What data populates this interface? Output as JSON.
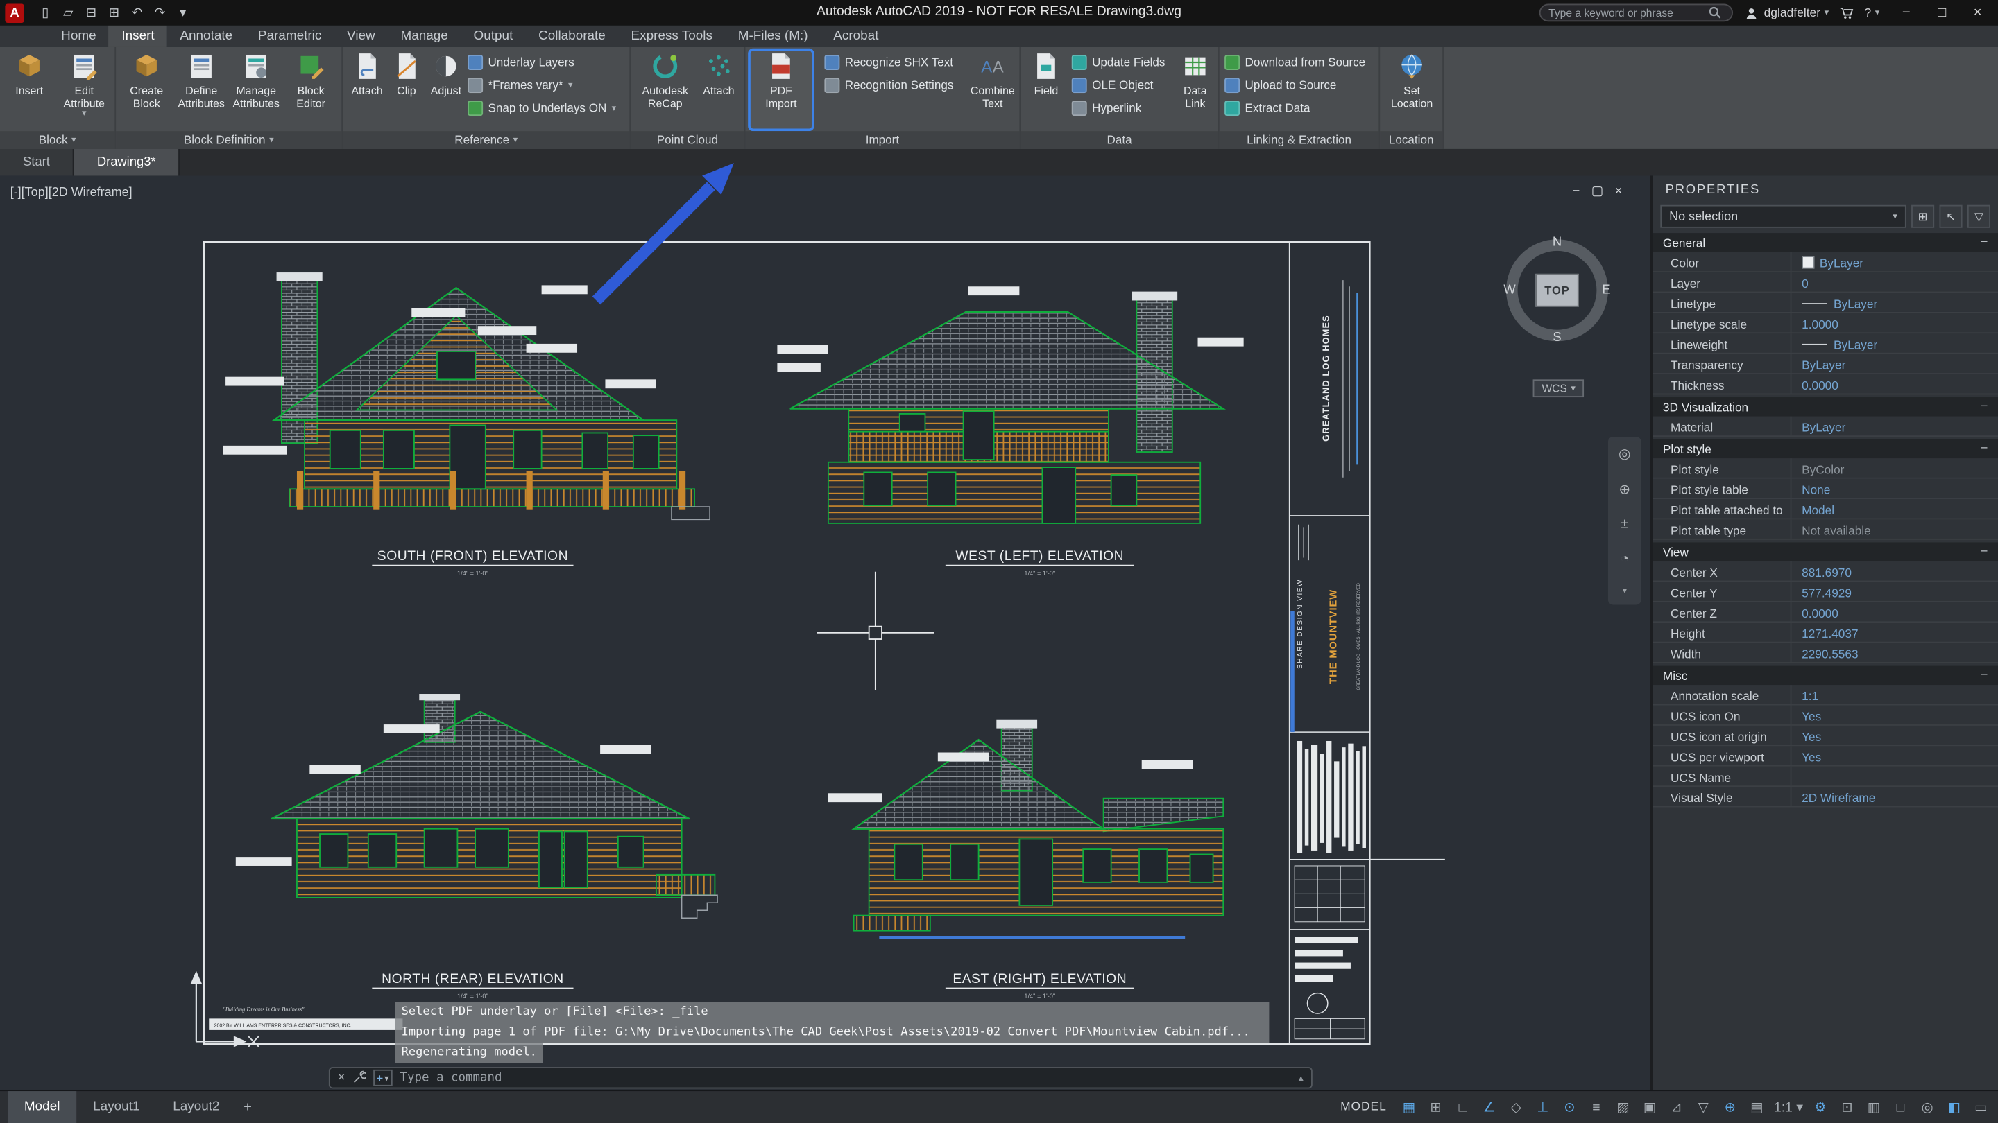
{
  "accent": {
    "highlight_blue": "#3d82e8",
    "value_blue": "#74a4d0",
    "cad_green": "#0fae3c",
    "log_orange": "#c9872d",
    "annotation_arrow_blue": "#2f5bd7"
  },
  "titlebar": {
    "app_title": "Autodesk AutoCAD 2019 - NOT FOR RESALE    Drawing3.dwg",
    "search_placeholder": "Type a keyword or phrase",
    "username": "dgladfelter",
    "help": "?",
    "qat_icons": [
      {
        "name": "new-file-icon",
        "glyph": "▯"
      },
      {
        "name": "open-file-icon",
        "glyph": "▱"
      },
      {
        "name": "save-icon",
        "glyph": "⊟"
      },
      {
        "name": "plot-icon",
        "glyph": "⊞"
      },
      {
        "name": "undo-icon",
        "glyph": "↶"
      },
      {
        "name": "redo-icon",
        "glyph": "↷"
      },
      {
        "name": "qat-dropdown-icon",
        "glyph": "▾"
      }
    ],
    "window": {
      "minimize": "−",
      "maximize": "□",
      "close": "×"
    }
  },
  "ribbon_tabs": [
    {
      "label": "Home"
    },
    {
      "label": "Insert",
      "active": true
    },
    {
      "label": "Annotate"
    },
    {
      "label": "Parametric"
    },
    {
      "label": "View"
    },
    {
      "label": "Manage"
    },
    {
      "label": "Output"
    },
    {
      "label": "Collaborate"
    },
    {
      "label": "Express Tools"
    },
    {
      "label": "M-Files (M:)"
    },
    {
      "label": "Acrobat"
    }
  ],
  "ribbon": {
    "block": {
      "label": "Block",
      "insert": "Insert",
      "edit_attribute": "Edit Attribute"
    },
    "block_definition": {
      "label": "Block Definition",
      "create_block": "Create Block",
      "define_attributes": "Define Attributes",
      "manage_attributes": "Manage Attributes",
      "block_editor": "Block Editor"
    },
    "reference": {
      "label": "Reference",
      "attach": "Attach",
      "clip": "Clip",
      "adjust": "Adjust",
      "underlay_layers": "Underlay Layers",
      "frames": "*Frames vary*",
      "snap": "Snap to Underlays ON"
    },
    "point_cloud": {
      "label": "Point Cloud",
      "recap": "Autodesk ReCap",
      "attach": "Attach"
    },
    "import": {
      "label": "Import",
      "pdf_import": "PDF Import",
      "recognize": "Recognize SHX Text",
      "settings": "Recognition Settings",
      "combine": "Combine Text"
    },
    "data": {
      "label": "Data",
      "field": "Field",
      "update_fields": "Update Fields",
      "ole_object": "OLE Object",
      "hyperlink": "Hyperlink",
      "data_link": "Data Link"
    },
    "linking": {
      "label": "Linking & Extraction",
      "download": "Download from Source",
      "upload": "Upload to Source",
      "extract": "Extract Data"
    },
    "location": {
      "label": "Location",
      "set_location": "Set Location"
    }
  },
  "file_tabs": [
    {
      "label": "Start"
    },
    {
      "label": "Drawing3*",
      "active": true
    }
  ],
  "viewport": {
    "label": "[-][Top][2D Wireframe]",
    "compass": {
      "n": "N",
      "w": "W",
      "e": "E",
      "s": "S",
      "top": "TOP",
      "wcs": "WCS"
    }
  },
  "drawing": {
    "elevations": [
      {
        "label": "SOUTH (FRONT) ELEVATION",
        "scale": "1/4\" = 1'-0\""
      },
      {
        "label": "WEST (LEFT) ELEVATION",
        "scale": "1/4\" = 1'-0\""
      },
      {
        "label": "NORTH (REAR) ELEVATION",
        "scale": "1/4\" = 1'-0\""
      },
      {
        "label": "EAST (RIGHT) ELEVATION",
        "scale": "1/4\" = 1'-0\""
      }
    ],
    "title_block": {
      "company": "GREATLAND LOG HOMES",
      "project": "THE MOUNTVIEW",
      "share": "SHARE DESIGN VIEW",
      "rights": "GREATLAND LOG HOMES · ALL RIGHTS RESERVED",
      "motto": "\"Building Dreams is Our Business\"",
      "copyright": "2002 BY WILLIAMS ENTERPRISES & CONSTRUCTORS, INC."
    }
  },
  "command": {
    "history": [
      "Select PDF underlay or [File] <File>: _file",
      "Importing page 1 of PDF file: G:\\My Drive\\Documents\\The CAD Geek\\Post Assets\\2019-02 Convert PDF\\Mountview Cabin.pdf...",
      "Regenerating model."
    ],
    "prompt": "Type a command"
  },
  "layout_tabs": [
    {
      "label": "Model",
      "active": true
    },
    {
      "label": "Layout1"
    },
    {
      "label": "Layout2"
    }
  ],
  "statusbar": {
    "model_label": "MODEL",
    "icons": [
      {
        "name": "grid-icon",
        "glyph": "▦",
        "on": true
      },
      {
        "name": "snap-mode-icon",
        "glyph": "⊞",
        "on": false
      },
      {
        "name": "ortho-icon",
        "glyph": "∟",
        "on": false
      },
      {
        "name": "polar-tracking-icon",
        "glyph": "∠",
        "on": true
      },
      {
        "name": "isometric-drafting-icon",
        "glyph": "◇",
        "on": false
      },
      {
        "name": "osnap-tracking-icon",
        "glyph": "⊥",
        "on": true
      },
      {
        "name": "object-snap-icon",
        "glyph": "⊙",
        "on": true
      },
      {
        "name": "lineweight-icon",
        "glyph": "≡",
        "on": false
      },
      {
        "name": "transparency-icon",
        "glyph": "▨",
        "on": false
      },
      {
        "name": "selection-cycling-icon",
        "glyph": "▣",
        "on": false
      },
      {
        "name": "dynamic-ucs-icon",
        "glyph": "⊿",
        "on": false
      },
      {
        "name": "selection-filter-icon",
        "glyph": "▽",
        "on": false
      },
      {
        "name": "gizmo-icon",
        "glyph": "⊕",
        "on": true
      },
      {
        "name": "annotation-visibility-icon",
        "glyph": "▤",
        "on": false
      },
      {
        "name": "annotation-scale-control",
        "glyph": "1:1 ▾",
        "on": false
      },
      {
        "name": "workspace-gear-icon",
        "glyph": "⚙",
        "on": true
      },
      {
        "name": "annotation-monitor-icon",
        "glyph": "⊡",
        "on": false
      },
      {
        "name": "quick-properties-icon",
        "glyph": "▥",
        "on": false
      },
      {
        "name": "lock-ui-icon",
        "glyph": "□",
        "on": false
      },
      {
        "name": "isolate-objects-icon",
        "glyph": "◎",
        "on": false
      },
      {
        "name": "graphics-performance-icon",
        "glyph": "◧",
        "on": true
      },
      {
        "name": "clean-screen-icon",
        "glyph": "▭",
        "on": false
      }
    ]
  },
  "properties": {
    "title": "PROPERTIES",
    "selection": "No selection",
    "sections": [
      {
        "name": "General",
        "rows": [
          {
            "label": "Color",
            "value": "ByLayer"
          },
          {
            "label": "Layer",
            "value": "0"
          },
          {
            "label": "Linetype",
            "value": "ByLayer"
          },
          {
            "label": "Linetype scale",
            "value": "1.0000"
          },
          {
            "label": "Lineweight",
            "value": "ByLayer"
          },
          {
            "label": "Transparency",
            "value": "ByLayer"
          },
          {
            "label": "Thickness",
            "value": "0.0000"
          }
        ]
      },
      {
        "name": "3D Visualization",
        "rows": [
          {
            "label": "Material",
            "value": "ByLayer"
          }
        ]
      },
      {
        "name": "Plot style",
        "rows": [
          {
            "label": "Plot style",
            "value": "ByColor"
          },
          {
            "label": "Plot style table",
            "value": "None"
          },
          {
            "label": "Plot table attached to",
            "value": "Model"
          },
          {
            "label": "Plot table type",
            "value": "Not available"
          }
        ]
      },
      {
        "name": "View",
        "rows": [
          {
            "label": "Center X",
            "value": "881.6970"
          },
          {
            "label": "Center Y",
            "value": "577.4929"
          },
          {
            "label": "Center Z",
            "value": "0.0000"
          },
          {
            "label": "Height",
            "value": "1271.4037"
          },
          {
            "label": "Width",
            "value": "2290.5563"
          }
        ]
      },
      {
        "name": "Misc",
        "rows": [
          {
            "label": "Annotation scale",
            "value": "1:1"
          },
          {
            "label": "UCS icon On",
            "value": "Yes"
          },
          {
            "label": "UCS icon at origin",
            "value": "Yes"
          },
          {
            "label": "UCS per viewport",
            "value": "Yes"
          },
          {
            "label": "UCS Name",
            "value": ""
          },
          {
            "label": "Visual Style",
            "value": "2D Wireframe"
          }
        ]
      }
    ]
  }
}
